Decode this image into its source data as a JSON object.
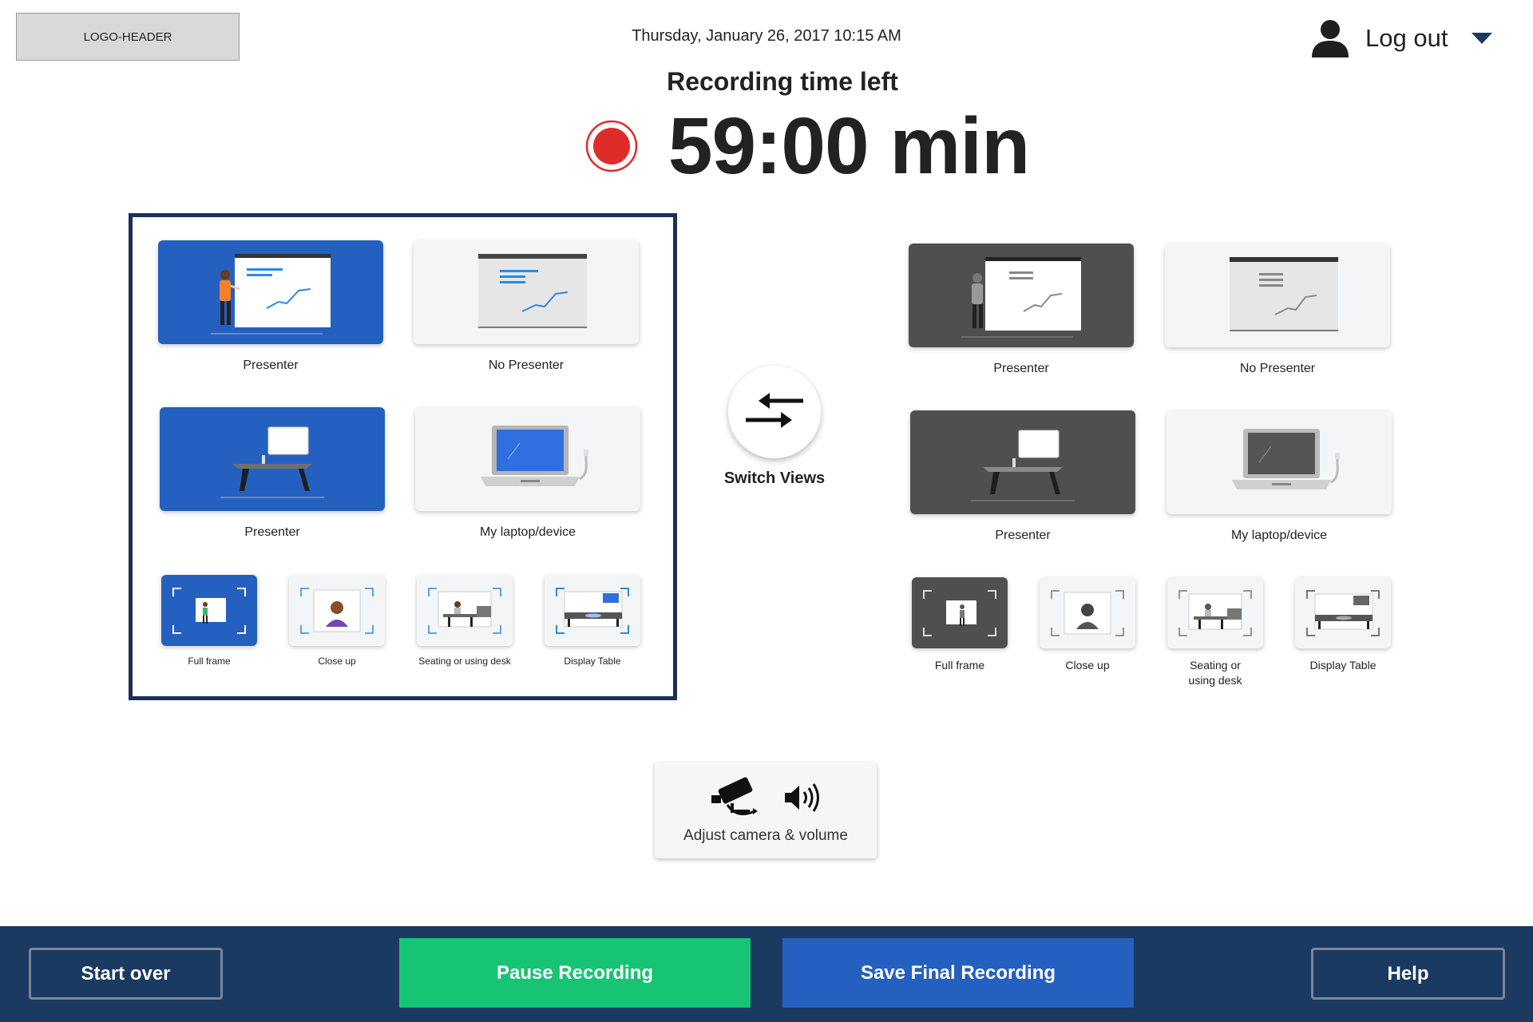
{
  "header": {
    "logo_text": "LOGO-HEADER",
    "datetime": "Thursday, January  26, 2017 10:15 AM",
    "logout_label": "Log out"
  },
  "recording": {
    "title": "Recording time left",
    "time_left": "59:00 min"
  },
  "left_panel": {
    "selected": true,
    "big_tiles": [
      {
        "label": "Presenter",
        "icon": "presenter-board-icon"
      },
      {
        "label": "No Presenter",
        "icon": "empty-board-icon"
      },
      {
        "label": "Presenter",
        "icon": "desk-presenter-icon"
      },
      {
        "label": "My laptop/device",
        "icon": "laptop-icon"
      }
    ],
    "small_tiles": [
      {
        "label": "Full frame",
        "icon": "full-frame-icon"
      },
      {
        "label": "Close up",
        "icon": "close-up-icon"
      },
      {
        "label": "Seating or using desk",
        "icon": "desk-seat-icon"
      },
      {
        "label": "Display Table",
        "icon": "display-table-icon"
      }
    ]
  },
  "right_panel": {
    "big_tiles": [
      {
        "label": "Presenter",
        "icon": "presenter-board-icon"
      },
      {
        "label": "No Presenter",
        "icon": "empty-board-icon"
      },
      {
        "label": "Presenter",
        "icon": "desk-presenter-icon"
      },
      {
        "label": "My laptop/device",
        "icon": "laptop-icon"
      }
    ],
    "small_tiles": [
      {
        "label": "Full frame",
        "icon": "full-frame-icon"
      },
      {
        "label": "Close up",
        "icon": "close-up-icon"
      },
      {
        "label": "Seating or using desk",
        "icon": "desk-seat-icon"
      },
      {
        "label": "Display Table",
        "icon": "display-table-icon"
      }
    ]
  },
  "switch": {
    "label": "Switch Views",
    "icon": "swap-arrows-icon"
  },
  "adjust": {
    "label": "Adjust camera & volume",
    "icons": [
      "camera-icon",
      "volume-icon"
    ]
  },
  "footer": {
    "start_over": "Start over",
    "pause": "Pause Recording",
    "save": "Save Final Recording",
    "help": "Help"
  },
  "colors": {
    "accent_blue": "#2460bf",
    "footer_navy": "#1b3a61",
    "pause_green": "#17c474",
    "record_red": "#e02b2b",
    "inactive_gray": "#4f4f4f"
  }
}
